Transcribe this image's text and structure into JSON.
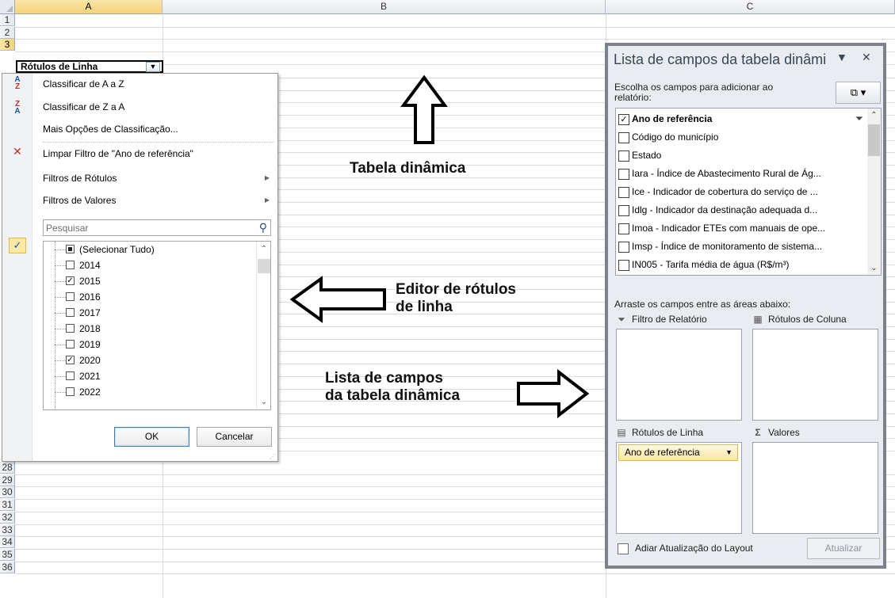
{
  "sheet": {
    "columns": [
      "A",
      "B",
      "C"
    ],
    "selected_column": "A",
    "rows_top": [
      "1",
      "2",
      "3"
    ],
    "selected_row": "3",
    "rows_bottom": [
      "28",
      "29",
      "30",
      "31",
      "32",
      "33",
      "34",
      "35",
      "36"
    ],
    "cell_a3": "Rótulos de Linha"
  },
  "filter_menu": {
    "sort_az": "Classificar de A a Z",
    "sort_za": "Classificar de Z a A",
    "more_sort": "Mais Opções de Classificação...",
    "clear_filter": "Limpar Filtro de \"Ano de referência\"",
    "label_filters": "Filtros de Rótulos",
    "value_filters": "Filtros de Valores",
    "search_placeholder": "Pesquisar",
    "select_all": "(Selecionar Tudo)",
    "years": [
      {
        "label": "2014",
        "checked": false
      },
      {
        "label": "2015",
        "checked": true
      },
      {
        "label": "2016",
        "checked": false
      },
      {
        "label": "2017",
        "checked": false
      },
      {
        "label": "2018",
        "checked": false
      },
      {
        "label": "2019",
        "checked": false
      },
      {
        "label": "2020",
        "checked": true
      },
      {
        "label": "2021",
        "checked": false
      },
      {
        "label": "2022",
        "checked": false
      }
    ],
    "ok": "OK",
    "cancel": "Cancelar"
  },
  "annotations": {
    "pivot_table": "Tabela dinâmica",
    "row_label_editor": "Editor de rótulos\nde linha",
    "field_list": "Lista de campos\nda tabela dinâmica"
  },
  "field_list": {
    "title": "Lista de campos da tabela dinâmi",
    "instruction": "Escolha os campos para adicionar ao relatório:",
    "fields": [
      {
        "label": "Ano de referência",
        "checked": true,
        "bold": true
      },
      {
        "label": "Código do município",
        "checked": false,
        "bold": false
      },
      {
        "label": "Estado",
        "checked": false,
        "bold": false
      },
      {
        "label": "Iara - Índice de Abastecimento Rural de Ág...",
        "checked": false,
        "bold": false
      },
      {
        "label": "Ice - Indicador de cobertura do serviço de ...",
        "checked": false,
        "bold": false
      },
      {
        "label": "Idlg - Indicador da destinação adequada d...",
        "checked": false,
        "bold": false
      },
      {
        "label": "Imoa - Indicador ETEs com manuais de ope...",
        "checked": false,
        "bold": false
      },
      {
        "label": "Imsp - Índice de monitoramento de sistema...",
        "checked": false,
        "bold": false
      },
      {
        "label": "IN005 - Tarifa média de água (R$/m³)",
        "checked": false,
        "bold": false
      }
    ],
    "drag_instruction": "Arraste os campos entre as áreas abaixo:",
    "report_filter": "Filtro de Relatório",
    "column_labels": "Rótulos de Coluna",
    "row_labels": "Rótulos de Linha",
    "values": "Valores",
    "row_chip": "Ano de referência",
    "defer_update": "Adiar Atualização do Layout",
    "update": "Atualizar"
  }
}
